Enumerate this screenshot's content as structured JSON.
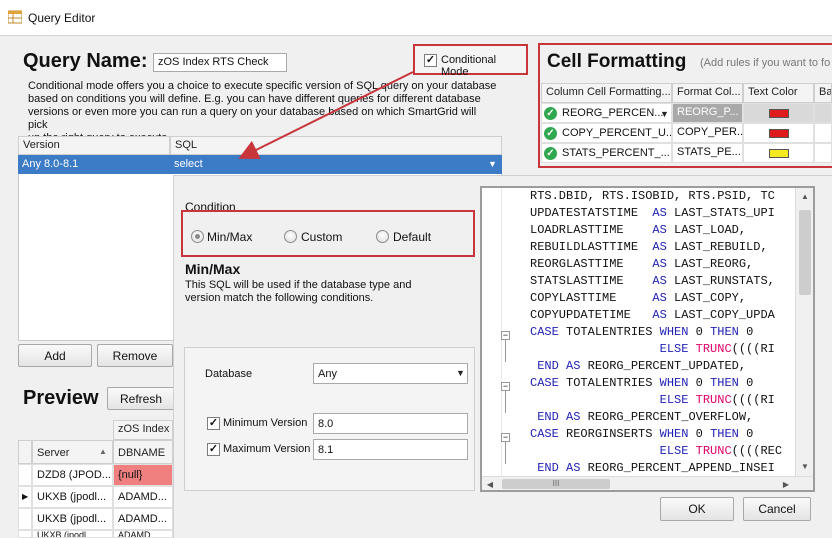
{
  "window": {
    "title": "Query Editor"
  },
  "query": {
    "name_label": "Query Name:",
    "name_value": "zOS Index RTS Check",
    "conditional_mode_label": "Conditional Mode",
    "conditional_mode_checked": true,
    "description": [
      "Conditional mode offers you a choice to execute specific version of SQL query on your database",
      "based on conditions you will define. E.g. you can have different queries for different database",
      "versions or even more you can run a query on your database based on which SmartGrid will pick",
      "up the right query to execute."
    ]
  },
  "version_grid": {
    "headers": [
      "Version",
      "SQL"
    ],
    "rows": [
      {
        "version": "Any 8.0-8.1",
        "sql": "select"
      }
    ],
    "add_label": "Add",
    "remove_label": "Remove"
  },
  "cell_formatting": {
    "title": "Cell Formatting",
    "hint": "(Add rules if you want to fo",
    "headers": [
      "Column Cell Formatting...",
      "Format Col...",
      "Text Color",
      "Bac"
    ],
    "rows": [
      {
        "column": "REORG_PERCEN...",
        "format": "REORG_P...",
        "color": "#e01b1b"
      },
      {
        "column": "COPY_PERCENT_U...",
        "format": "COPY_PER...",
        "color": "#e01b1b"
      },
      {
        "column": "STATS_PERCENT_...",
        "format": "STATS_PE...",
        "color": "#f5ea22"
      }
    ]
  },
  "condition": {
    "group_label": "Condition",
    "options": [
      "Min/Max",
      "Custom",
      "Default"
    ],
    "selected": "Min/Max",
    "minmax_title": "Min/Max",
    "minmax_desc": [
      "This SQL will be used if the database type and",
      "version match the following conditions."
    ],
    "database_label": "Database",
    "database_value": "Any",
    "min_version_label": "Minimum Version",
    "min_version_value": "8.0",
    "min_version_checked": true,
    "max_version_label": "Maximum Version",
    "max_version_value": "8.1",
    "max_version_checked": true
  },
  "sql_editor": {
    "lines": [
      "RTS.DBID, RTS.ISOBID, RTS.PSID, TC",
      "UPDATESTATSTIME  AS LAST_STATS_UPI",
      "LOADRLASTTIME    AS LAST_LOAD,",
      "REBUILDLASTTIME  AS LAST_REBUILD,",
      "REORGLASTTIME    AS LAST_REORG,",
      "STATSLASTTIME    AS LAST_RUNSTATS,",
      "COPYLASTTIME     AS LAST_COPY,",
      "COPYUPDATETIME   AS LAST_COPY_UPDA",
      "CASE TOTALENTRIES WHEN 0 THEN 0",
      "                  ELSE TRUNC((((RI",
      " END AS REORG_PERCENT_UPDATED,",
      "CASE TOTALENTRIES WHEN 0 THEN 0",
      "                  ELSE TRUNC((((RI",
      " END AS REORG_PERCENT_OVERFLOW,",
      "CASE REORGINSERTS WHEN 0 THEN 0",
      "                  ELSE TRUNC((((REC",
      " END AS REORG_PERCENT_APPEND_INSEI"
    ],
    "hscroll_glyph": "III"
  },
  "preview": {
    "title": "Preview",
    "refresh_label": "Refresh",
    "group_header": "zOS Index F",
    "headers": [
      "Server",
      "DBNAME"
    ],
    "rows": [
      {
        "server": "DZD8 (JPOD...",
        "dbname": "{null}",
        "highlight": true
      },
      {
        "server": "UKXB (jpodl...",
        "dbname": "ADAMD...",
        "current": true
      },
      {
        "server": "UKXB (jpodl...",
        "dbname": "ADAMD..."
      },
      {
        "server": "UKXB (jpodl...",
        "dbname": "ADAMD..."
      }
    ]
  },
  "footer": {
    "ok_label": "OK",
    "cancel_label": "Cancel"
  },
  "colors": {
    "selection": "#3c7bc6",
    "annotation_red": "#c8353b",
    "null_cell": "#f08080"
  }
}
